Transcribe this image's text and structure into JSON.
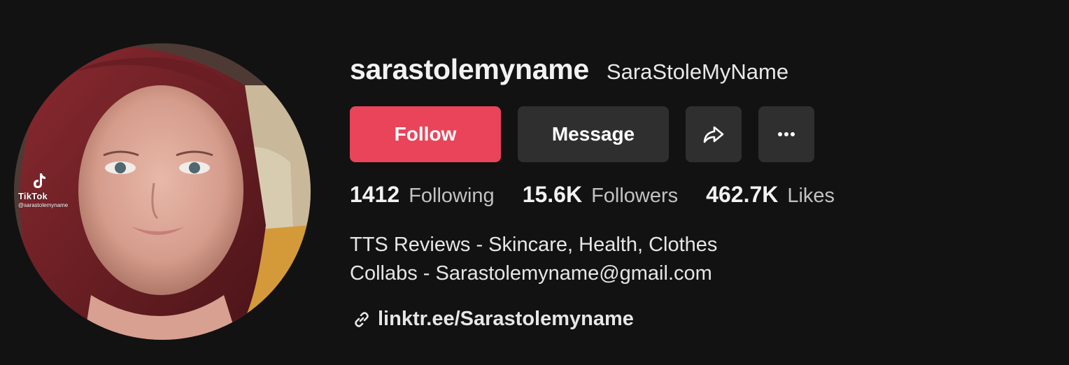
{
  "profile": {
    "username": "sarastolemyname",
    "nickname": "SaraStoleMyName",
    "avatar_watermark": {
      "brand": "TikTok",
      "handle": "@sarastolemyname"
    }
  },
  "actions": {
    "follow_label": "Follow",
    "message_label": "Message",
    "share_icon": "share-arrow-icon",
    "more_icon": "more-dots-icon"
  },
  "stats": {
    "following": {
      "value": "1412",
      "label": "Following"
    },
    "followers": {
      "value": "15.6K",
      "label": "Followers"
    },
    "likes": {
      "value": "462.7K",
      "label": "Likes"
    }
  },
  "bio": {
    "line1": "TTS Reviews - Skincare, Health, Clothes",
    "line2": "Collabs - Sarastolemyname@gmail.com"
  },
  "link": {
    "icon": "link-chain-icon",
    "text": "linktr.ee/Sarastolemyname"
  },
  "colors": {
    "background": "#121212",
    "follow_button": "#ea445a",
    "secondary_button": "#2f2f2f"
  }
}
